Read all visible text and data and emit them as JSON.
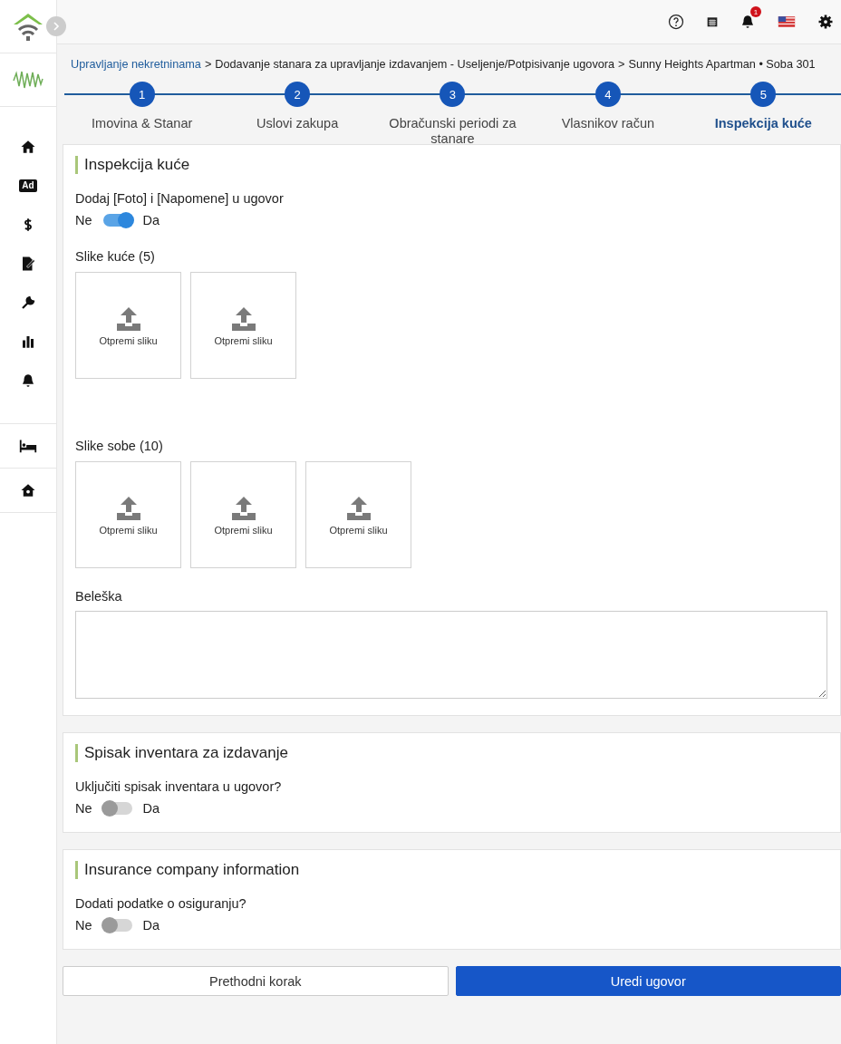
{
  "sidebar": {
    "ad_label": "Ad"
  },
  "topbar": {
    "notification_count": "1"
  },
  "breadcrumb": {
    "separator": ">",
    "items": [
      {
        "label": "Upravljanje nekretninama",
        "link": true
      },
      {
        "label": "Dodavanje stanara za upravljanje izdavanjem - Useljenje/Potpisivanje ugovora",
        "link": false
      },
      {
        "label": "Sunny Heights Apartman • Soba 301",
        "link": false
      }
    ]
  },
  "steps": [
    {
      "number": "1",
      "label": "Imovina & Stanar",
      "selected": false
    },
    {
      "number": "2",
      "label": "Uslovi zakupa",
      "selected": false
    },
    {
      "number": "3",
      "label": "Obračunski periodi za stanare",
      "selected": false
    },
    {
      "number": "4",
      "label": "Vlasnikov račun",
      "selected": false
    },
    {
      "number": "5",
      "label": "Inspekcija kuće",
      "selected": true
    }
  ],
  "sections": [
    {
      "title": "Inspekcija kuće",
      "question": "Dodaj [Foto] i [Napomene] u ugovor",
      "off_label": "Ne",
      "on_label": "Da",
      "on": true,
      "galleries": [
        {
          "title": "Slike kuće (5)",
          "tiles": [
            "Otpremi sliku",
            "Otpremi sliku"
          ]
        },
        {
          "title": "Slike sobe (10)",
          "tiles": [
            "Otpremi sliku",
            "Otpremi sliku",
            "Otpremi sliku"
          ]
        }
      ],
      "note": {
        "label": "Beleška"
      }
    },
    {
      "title": "Spisak inventara za izdavanje",
      "question": "Uključiti spisak inventara u ugovor?",
      "off_label": "Ne",
      "on_label": "Da",
      "on": false
    },
    {
      "title": "Insurance company information",
      "question": "Dodati podatke o osiguranju?",
      "off_label": "Ne",
      "on_label": "Da",
      "on": false
    }
  ],
  "buttons": {
    "previous": "Prethodni korak",
    "primary": "Uredi ugovor"
  }
}
